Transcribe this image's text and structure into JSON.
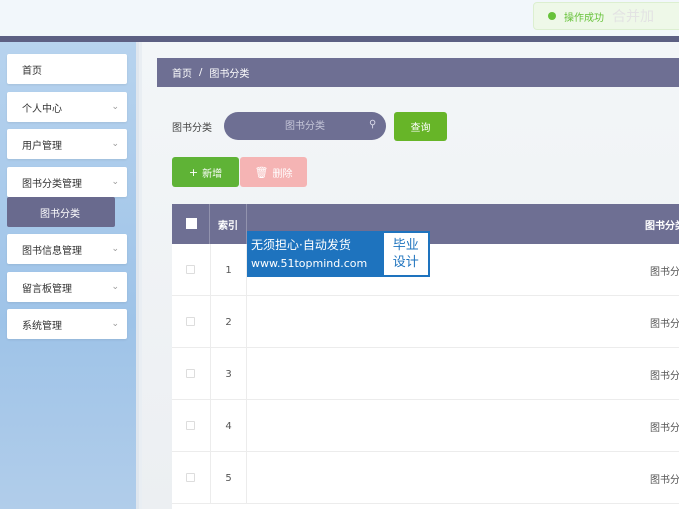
{
  "toast": {
    "message": "操作成功",
    "ghost_text": "合并加"
  },
  "sidebar": {
    "items": [
      {
        "label": "首页",
        "chevron": ""
      },
      {
        "label": "个人中心",
        "chevron": "⌄"
      },
      {
        "label": "用户管理",
        "chevron": "⌄"
      },
      {
        "label": "图书分类管理",
        "chevron": "⌄"
      },
      {
        "label": "图书信息管理",
        "chevron": "⌄"
      },
      {
        "label": "留言板管理",
        "chevron": "⌄"
      },
      {
        "label": "系统管理",
        "chevron": "⌄"
      }
    ],
    "active_sub": "图书分类"
  },
  "breadcrumb": {
    "home": "首页",
    "separator": "/",
    "current": "图书分类"
  },
  "search": {
    "label": "图书分类",
    "placeholder": "图书分类",
    "query_label": "查询"
  },
  "actions": {
    "add_label": "新增",
    "add_glyph": "+",
    "delete_label": "删除",
    "delete_glyph": "🗑"
  },
  "table": {
    "headers": {
      "index": "索引",
      "name": "图书分类"
    },
    "rows": [
      {
        "index": "1",
        "name": "图书分"
      },
      {
        "index": "2",
        "name": "图书分"
      },
      {
        "index": "3",
        "name": "图书分"
      },
      {
        "index": "4",
        "name": "图书分"
      },
      {
        "index": "5",
        "name": "图书分"
      }
    ]
  },
  "watermark": {
    "line1": "无须担心·自动发货",
    "line2": "www.51topmind.com",
    "badge_top": "毕业",
    "badge_bottom": "设计"
  },
  "colors": {
    "accent": "#6e6f93",
    "success": "#67b528",
    "danger_light": "#f5b4b4",
    "sidebar": "#a9cbee"
  }
}
